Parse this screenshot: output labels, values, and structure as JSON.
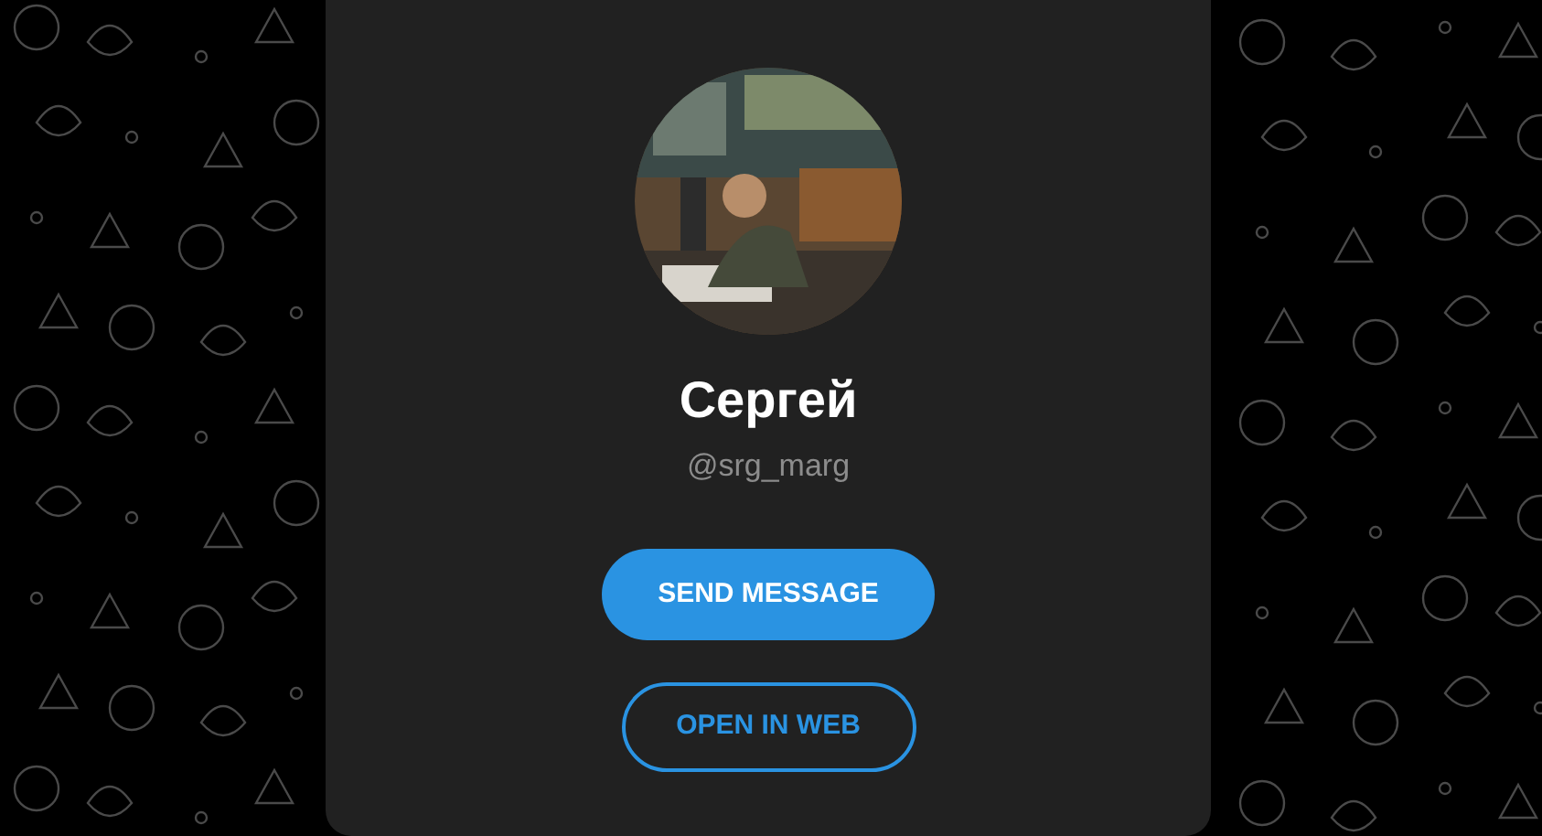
{
  "profile": {
    "name": "Сергей",
    "username": "@srg_marg"
  },
  "buttons": [
    {
      "label": "SEND MESSAGE",
      "kind": "filled"
    },
    {
      "label": "OPEN IN WEB",
      "kind": "outline"
    }
  ]
}
